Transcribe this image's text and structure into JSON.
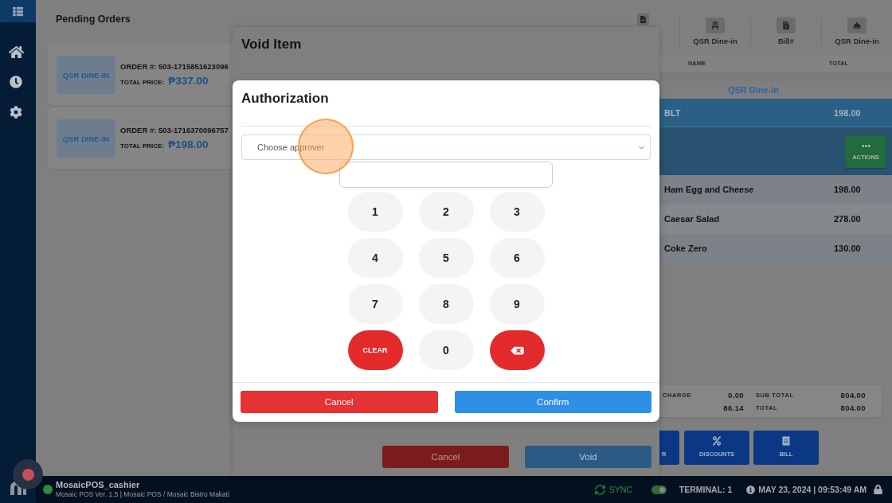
{
  "pending_orders": {
    "title": "Pending Orders",
    "orders": [
      {
        "type": "QSR DINE-IN",
        "order": "ORDER #: 503-1715851623096",
        "price_label": "TOTAL PRICE:",
        "price": "₱337.00"
      },
      {
        "type": "QSR DINE-IN",
        "order": "ORDER #: 503-1716370096757",
        "price_label": "TOTAL PRICE:",
        "price": "₱198.00"
      }
    ]
  },
  "void_dialog": {
    "title": "Void Item",
    "buttons": [
      {
        "label": "Cancel",
        "kind": "cancel"
      },
      {
        "label": "Void",
        "kind": "confirm"
      }
    ]
  },
  "authorization_dialog": {
    "title": "Authorization",
    "approver_select": {
      "placeholder": "Choose approver"
    },
    "keypad": [
      {
        "label": "1",
        "kind": "digit"
      },
      {
        "label": "2",
        "kind": "digit"
      },
      {
        "label": "3",
        "kind": "digit"
      },
      {
        "label": "4",
        "kind": "digit"
      },
      {
        "label": "5",
        "kind": "digit"
      },
      {
        "label": "6",
        "kind": "digit"
      },
      {
        "label": "7",
        "kind": "digit"
      },
      {
        "label": "8",
        "kind": "digit"
      },
      {
        "label": "9",
        "kind": "digit"
      },
      {
        "label": "CLEAR",
        "kind": "clear"
      },
      {
        "label": "0",
        "kind": "digit"
      },
      {
        "kind": "backspace"
      }
    ],
    "buttons": [
      {
        "label": "Cancel",
        "kind": "cancel"
      },
      {
        "label": "Confirm",
        "kind": "confirm"
      }
    ]
  },
  "order_panel": {
    "tabs": [
      {
        "label": "QSR Dine-in"
      },
      {
        "label": "Bill#"
      },
      {
        "label": "QSR Dine-in"
      }
    ],
    "columns": [
      "NAME",
      "TOTAL"
    ],
    "group": "QSR Dine-in",
    "items": [
      {
        "name": "BLT",
        "total": "198.00",
        "selected": true
      },
      {
        "name": "Ham Egg and Cheese",
        "total": "198.00",
        "selected": false
      },
      {
        "name": "Caesar Salad",
        "total": "278.00",
        "selected": false
      },
      {
        "name": "Coke Zero",
        "total": "130.00",
        "selected": false
      }
    ],
    "actions_button": "ACTIONS",
    "summary": {
      "left": [
        {
          "label": "CHARGE",
          "value": "0.00"
        },
        {
          "value": "86.14"
        }
      ],
      "right": [
        {
          "label": "SUB TOTAL",
          "value": "804.00"
        },
        {
          "label": "TOTAL",
          "value": "804.00"
        }
      ]
    },
    "buttons": [
      {
        "label": "R"
      },
      {
        "label": "DISCOUNTS"
      },
      {
        "label": "BILL"
      }
    ]
  },
  "status_bar": {
    "online": true,
    "user": "MosaicPOS_cashier",
    "details": "Mosaic POS Ver. 1.5 | Mosaic POS / Mosaic Bistro Makati",
    "sync": "SYNC",
    "sync_toggle": {
      "on": true
    },
    "terminal": "TERMINAL: 1",
    "datetime": "MAY 23, 2024 | 09:53:49 AM"
  }
}
